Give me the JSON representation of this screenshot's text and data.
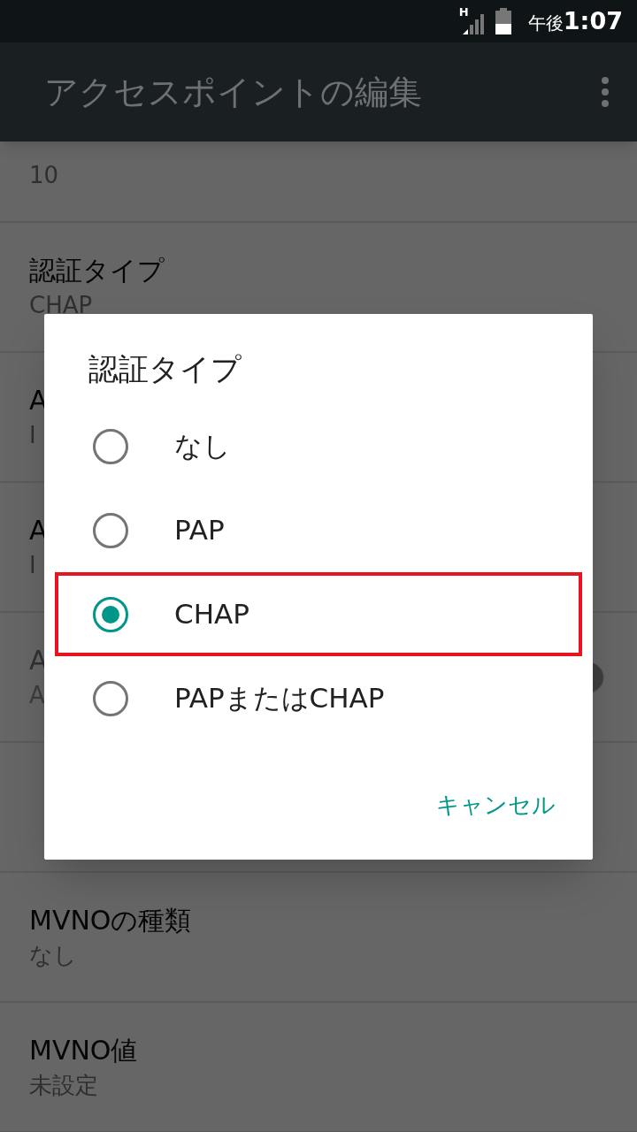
{
  "status_bar": {
    "network": "H",
    "time_prefix": "午後",
    "time": "1:07"
  },
  "app_bar": {
    "title": "アクセスポイントの編集"
  },
  "settings": [
    {
      "value": "10",
      "disabled": false
    },
    {
      "title": "認証タイプ",
      "value": "CHAP",
      "disabled": false
    },
    {
      "title": "A",
      "value": "I",
      "disabled": false
    },
    {
      "title": "A",
      "value": "I",
      "disabled": false
    },
    {
      "title": "A",
      "value": "A",
      "disabled": true,
      "kind": "switch",
      "on": false
    },
    {
      "kind": "blank"
    },
    {
      "title": "MVNOの種類",
      "value": "なし",
      "disabled": false
    },
    {
      "title": "MVNO値",
      "value": "未設定",
      "disabled": false
    }
  ],
  "dialog": {
    "title": "認証タイプ",
    "options": [
      {
        "label": "なし",
        "selected": false,
        "highlighted": false
      },
      {
        "label": "PAP",
        "selected": false,
        "highlighted": false
      },
      {
        "label": "CHAP",
        "selected": true,
        "highlighted": true
      },
      {
        "label": "PAPまたはCHAP",
        "selected": false,
        "highlighted": false
      }
    ],
    "buttons": [
      "キャンセル"
    ]
  }
}
